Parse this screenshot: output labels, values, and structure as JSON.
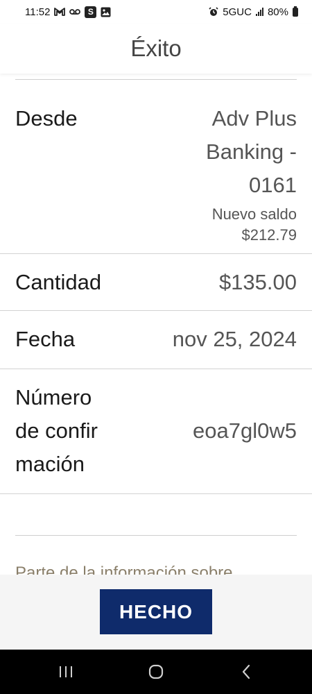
{
  "status_bar": {
    "time": "11:52",
    "network": "5GUC",
    "battery": "80%",
    "left_icons": [
      "gmail-icon",
      "voicemail-icon",
      "s-app-icon",
      "gallery-icon"
    ],
    "right_icons": [
      "alarm-icon",
      "signal-icon",
      "battery-icon"
    ]
  },
  "header": {
    "title": "Éxito"
  },
  "details": {
    "from": {
      "label": "Desde",
      "account_line1": "Adv Plus",
      "account_line2": "Banking -",
      "account_line3": "0161",
      "balance_label": "Nuevo saldo",
      "balance_value": "$212.79"
    },
    "amount": {
      "label": "Cantidad",
      "value": "$135.00"
    },
    "date": {
      "label": "Fecha",
      "value": "nov 25, 2024"
    },
    "confirmation": {
      "label_line1": "Número",
      "label_line2": "de confir",
      "label_line3": "mación",
      "value": "eoa7gl0w5"
    }
  },
  "info_text": "Parte de la información sobre",
  "footer": {
    "done_label": "HECHO",
    "done_color": "#0f2b6b"
  },
  "nav": {
    "icons": [
      "recents-icon",
      "home-icon",
      "back-icon"
    ]
  }
}
